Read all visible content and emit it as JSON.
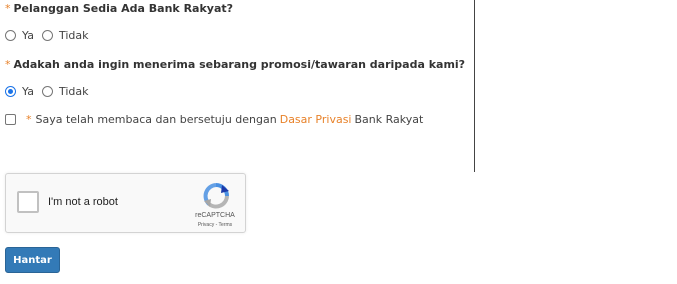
{
  "form": {
    "q1": {
      "required_mark": "*",
      "label": "Pelanggan Sedia Ada Bank Rakyat?",
      "options": [
        "Ya",
        "Tidak"
      ],
      "selected": null
    },
    "q2": {
      "required_mark": "*",
      "label": "Adakah anda ingin menerima sebarang promosi/tawaran daripada kami?",
      "options": [
        "Ya",
        "Tidak"
      ],
      "selected": "Ya"
    },
    "consent": {
      "required_mark": "*",
      "text_before": "Saya telah membaca dan bersetuju dengan",
      "link_text": "Dasar Privasi",
      "text_after": "Bank Rakyat",
      "checked": false
    }
  },
  "captcha": {
    "label": "I'm not a robot",
    "brand": "reCAPTCHA",
    "terms": "Privacy - Terms",
    "checked": false
  },
  "submit": {
    "label": "Hantar"
  },
  "colors": {
    "required_mark": "#e8822a",
    "link": "#e8822a",
    "button_bg": "#337ab7",
    "radio_checked": "#1a73e8"
  }
}
